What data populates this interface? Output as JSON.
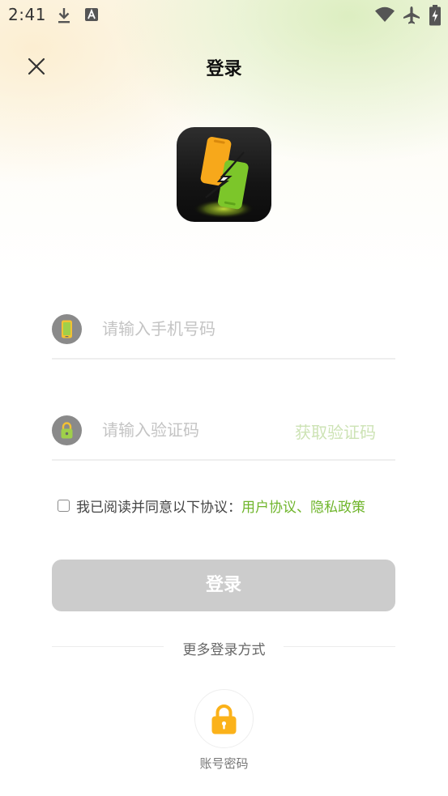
{
  "status_bar": {
    "time": "2:41",
    "icons": [
      "download-icon",
      "font-a-icon",
      "wifi-icon",
      "airplane-icon",
      "battery-charging-icon"
    ]
  },
  "header": {
    "title": "登录",
    "close_icon": "close-icon"
  },
  "logo": {
    "icon": "app-logo-icon",
    "colors": {
      "orange": "#f7a81b",
      "green": "#7cc62a",
      "bolt": "#ffffff"
    }
  },
  "phone_field": {
    "icon": "phone-icon",
    "value": "",
    "placeholder": "请输入手机号码"
  },
  "code_field": {
    "icon": "lock-icon",
    "value": "",
    "placeholder": "请输入验证码",
    "get_code_label": "获取验证码"
  },
  "agreement": {
    "checked": false,
    "text": "我已阅读并同意以下协议：",
    "link_text": "用户协议、隐私政策"
  },
  "login_button": {
    "label": "登录"
  },
  "more_login": {
    "label": "更多登录方式",
    "options": [
      {
        "icon": "lock-icon",
        "label": "账号密码"
      }
    ]
  },
  "colors": {
    "accent_green": "#6fb52b",
    "get_code_disabled": "#cde3b5",
    "button_disabled": "#cccccc",
    "lock_orange": "#fbb21a"
  }
}
